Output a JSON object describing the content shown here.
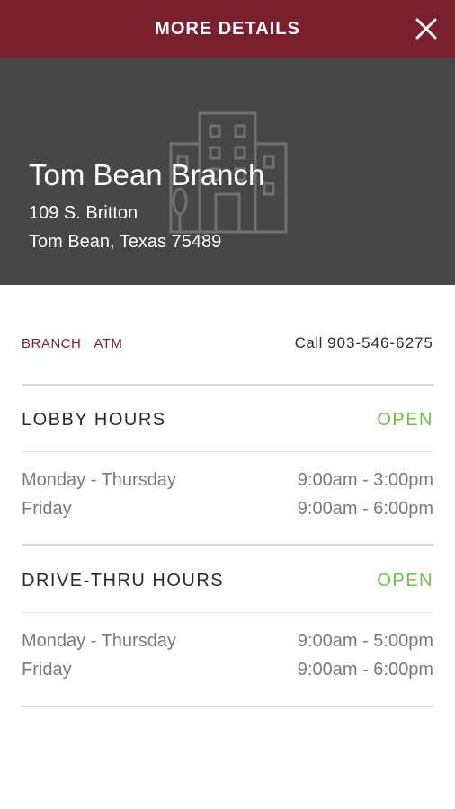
{
  "header": {
    "title": "MORE DETAILS",
    "close_icon": "close-icon"
  },
  "branch": {
    "name": "Tom Bean Branch",
    "address_line1": "109 S. Britton",
    "address_line2": "Tom Bean, Texas 75489",
    "illustration": "building-icon"
  },
  "tags": [
    "BRANCH",
    "ATM"
  ],
  "contact": {
    "call_label": "Call",
    "phone": "903-546-6275"
  },
  "lobby": {
    "title": "LOBBY HOURS",
    "status": "OPEN",
    "rows": [
      {
        "days": "Monday - Thursday",
        "hours": "9:00am - 3:00pm"
      },
      {
        "days": "Friday",
        "hours": "9:00am - 6:00pm"
      }
    ]
  },
  "drive_thru": {
    "title": "DRIVE-THRU HOURS",
    "status": "OPEN",
    "rows": [
      {
        "days": "Monday - Thursday",
        "hours": "9:00am - 5:00pm"
      },
      {
        "days": "Friday",
        "hours": "9:00am - 6:00pm"
      }
    ]
  },
  "colors": {
    "brand": "#7a1f2e",
    "open": "#6cc24a",
    "hero_bg": "#474747"
  }
}
